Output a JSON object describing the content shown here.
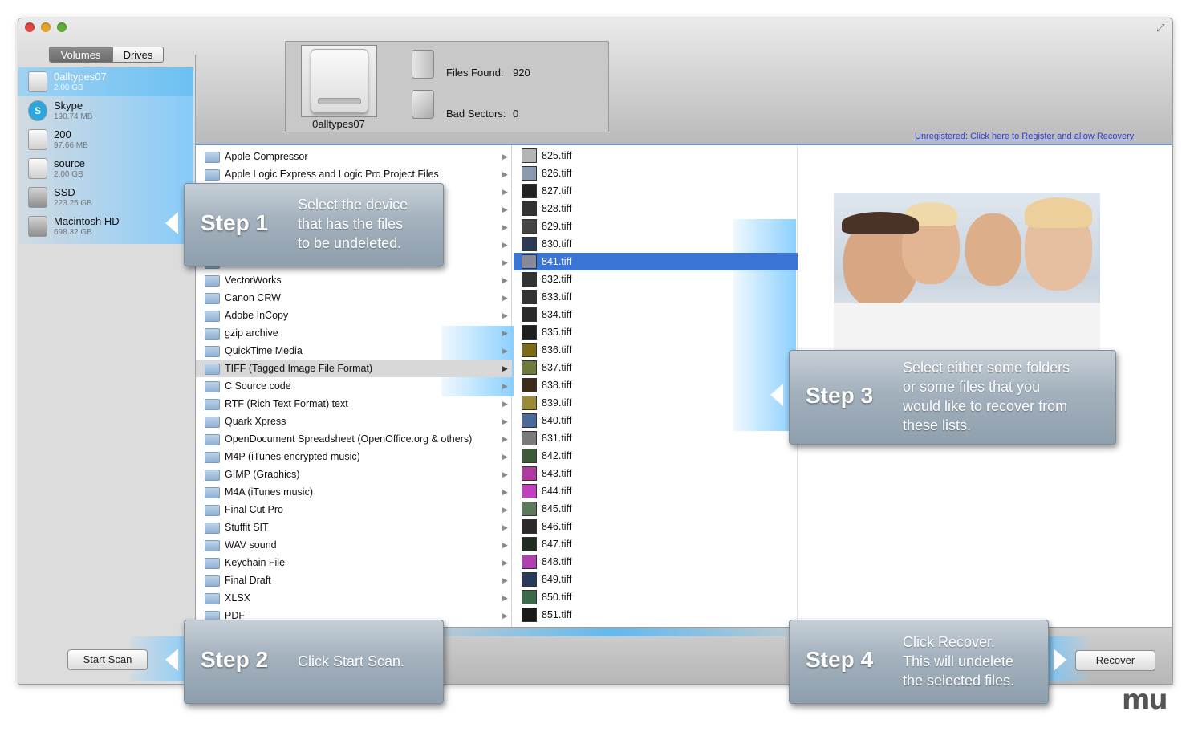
{
  "tabs": {
    "volumes": "Volumes",
    "drives": "Drives"
  },
  "volumes": [
    {
      "name": "0alltypes07",
      "size": "2.00 GB",
      "icon": "drive-icon"
    },
    {
      "name": "Skype",
      "size": "190.74 MB",
      "icon": "skype-icon"
    },
    {
      "name": "200",
      "size": "97.66 MB",
      "icon": "drive-icon"
    },
    {
      "name": "source",
      "size": "2.00 GB",
      "icon": "drive-icon"
    },
    {
      "name": "SSD",
      "size": "223.25 GB",
      "icon": "hard-disk-icon"
    },
    {
      "name": "Macintosh HD",
      "size": "698.32 GB",
      "icon": "hard-disk-icon"
    }
  ],
  "info": {
    "device_name": "0alltypes07",
    "files_found_label": "Files Found:",
    "files_found": "920",
    "bad_sectors_label": "Bad Sectors:",
    "bad_sectors": "0"
  },
  "register_link": "Unregistered: Click here to Register and allow Recovery",
  "folders": [
    "Apple Compressor",
    "Apple Logic Express and Logic Pro Project Files",
    "",
    "",
    "",
    "",
    "",
    "VectorWorks",
    "Canon CRW",
    "Adobe InCopy",
    "gzip archive",
    "QuickTime Media",
    "TIFF (Tagged Image File Format)",
    "C Source code",
    "RTF (Rich Text Format) text",
    "Quark Xpress",
    "OpenDocument Spreadsheet (OpenOffice.org & others)",
    "M4P (iTunes encrypted music)",
    "GIMP (Graphics)",
    "M4A (iTunes music)",
    "Final Cut Pro",
    "Stuffit SIT",
    "WAV sound",
    "Keychain File",
    "Final Draft",
    "XLSX",
    "PDF"
  ],
  "selected_folder": "TIFF (Tagged Image File Format)",
  "files": [
    "825.tiff",
    "826.tiff",
    "827.tiff",
    "828.tiff",
    "829.tiff",
    "830.tiff",
    "841.tiff",
    "832.tiff",
    "833.tiff",
    "834.tiff",
    "835.tiff",
    "836.tiff",
    "837.tiff",
    "838.tiff",
    "839.tiff",
    "840.tiff",
    "831.tiff",
    "842.tiff",
    "843.tiff",
    "844.tiff",
    "845.tiff",
    "846.tiff",
    "847.tiff",
    "848.tiff",
    "849.tiff",
    "850.tiff",
    "851.tiff"
  ],
  "selected_file": "841.tiff",
  "steps": [
    {
      "label": "Step 1",
      "text": "Select the device\nthat has the files\nto be undeleted."
    },
    {
      "label": "Step 2",
      "text": "Click Start Scan."
    },
    {
      "label": "Step 3",
      "text": "Select either some folders\nor some files that you\nwould like to recover from\nthese lists."
    },
    {
      "label": "Step 4",
      "text": "Click Recover.\nThis will undelete\nthe selected files."
    }
  ],
  "buttons": {
    "start_scan": "Start Scan",
    "recover": "Recover"
  },
  "colors": {
    "selection": "#3a75d6",
    "accent_blue": "#5fb9f0",
    "link": "#2b3cd6"
  }
}
